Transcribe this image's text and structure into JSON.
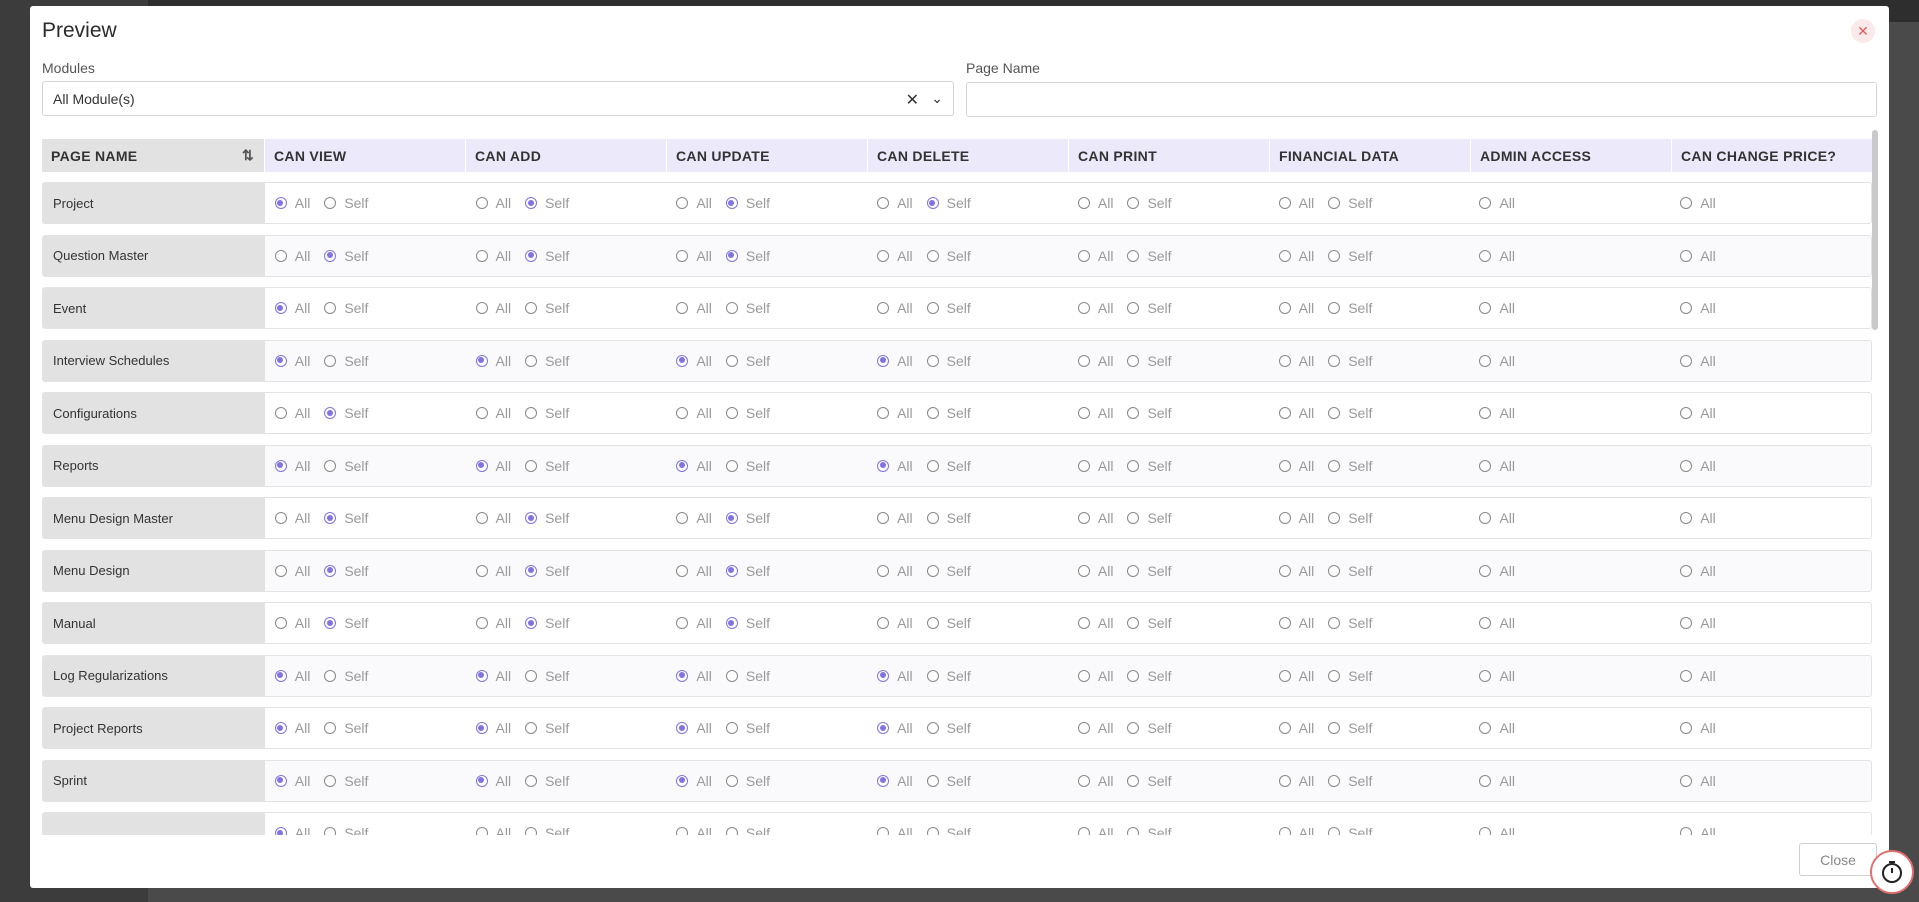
{
  "modal": {
    "title": "Preview",
    "modules_label": "Modules",
    "modules_value": "All Module(s)",
    "page_name_label": "Page Name",
    "page_name_value": "",
    "close_label": "Close"
  },
  "columns": [
    {
      "key": "page_name",
      "label": "PAGE NAME"
    },
    {
      "key": "can_view",
      "label": "CAN VIEW"
    },
    {
      "key": "can_add",
      "label": "CAN ADD"
    },
    {
      "key": "can_update",
      "label": "CAN UPDATE"
    },
    {
      "key": "can_delete",
      "label": "CAN DELETE"
    },
    {
      "key": "can_print",
      "label": "CAN PRINT"
    },
    {
      "key": "financial_data",
      "label": "FINANCIAL DATA"
    },
    {
      "key": "admin_access",
      "label": "ADMIN ACCESS"
    },
    {
      "key": "can_change_price",
      "label": "CAN CHANGE PRICE?"
    }
  ],
  "option_labels": {
    "all": "All",
    "self": "Self"
  },
  "rows": [
    {
      "name": "Project",
      "view": "All",
      "add": "Self",
      "update": "Self",
      "delete": "Self"
    },
    {
      "name": "Question Master",
      "view": "Self",
      "add": "Self",
      "update": "Self",
      "delete": ""
    },
    {
      "name": "Event",
      "view": "All",
      "add": "",
      "update": "",
      "delete": ""
    },
    {
      "name": "Interview Schedules",
      "view": "All",
      "add": "All",
      "update": "All",
      "delete": "All"
    },
    {
      "name": "Configurations",
      "view": "Self",
      "add": "",
      "update": "",
      "delete": ""
    },
    {
      "name": "Reports",
      "view": "All",
      "add": "All",
      "update": "All",
      "delete": "All"
    },
    {
      "name": "Menu Design Master",
      "view": "Self",
      "add": "Self",
      "update": "Self",
      "delete": ""
    },
    {
      "name": "Menu Design",
      "view": "Self",
      "add": "Self",
      "update": "Self",
      "delete": ""
    },
    {
      "name": "Manual",
      "view": "Self",
      "add": "Self",
      "update": "Self",
      "delete": ""
    },
    {
      "name": "Log Regularizations",
      "view": "All",
      "add": "All",
      "update": "All",
      "delete": "All"
    },
    {
      "name": "Project Reports",
      "view": "All",
      "add": "All",
      "update": "All",
      "delete": "All"
    },
    {
      "name": "Sprint",
      "view": "All",
      "add": "All",
      "update": "All",
      "delete": "All"
    },
    {
      "name": "",
      "view": "All",
      "add": "",
      "update": "",
      "delete": ""
    }
  ],
  "colors": {
    "accent": "#7f74e0",
    "header_bg": "#ece9fb",
    "close_x": "#e05c5c"
  },
  "icons": {
    "clear": "clear-icon",
    "chevron": "chevron-down-icon",
    "sort": "sort-icon",
    "timer": "stopwatch-icon",
    "close": "close-icon"
  }
}
